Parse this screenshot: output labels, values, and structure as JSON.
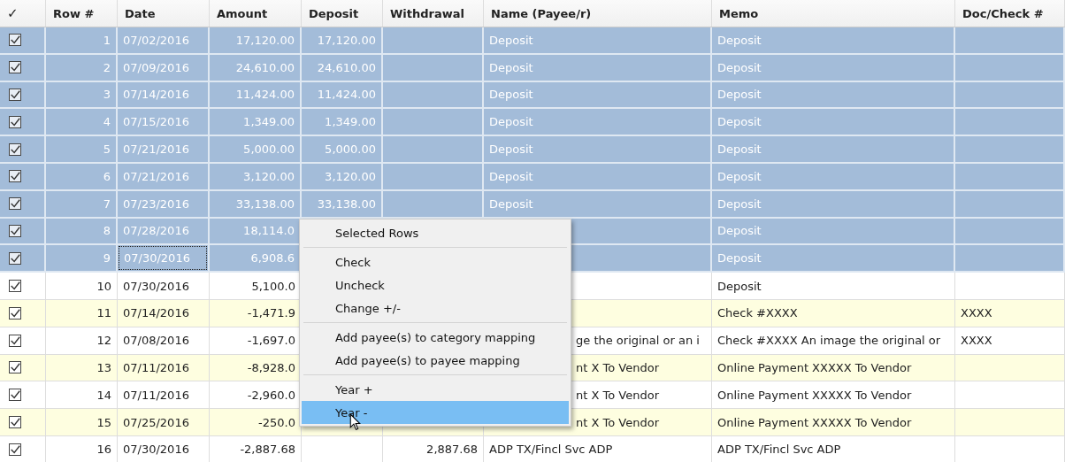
{
  "table": {
    "columns": [
      "✓",
      "Row #",
      "Date",
      "Amount",
      "Deposit",
      "Withdrawal",
      "Name (Payee/r)",
      "Memo",
      "Doc/Check #"
    ],
    "rows": [
      {
        "checked": true,
        "selected": true,
        "focused": false,
        "row": "1",
        "date": "07/02/2016",
        "amount": "17,120.00",
        "deposit": "17,120.00",
        "name": "Deposit",
        "memo": "Deposit"
      },
      {
        "checked": true,
        "selected": true,
        "focused": false,
        "row": "2",
        "date": "07/09/2016",
        "amount": "24,610.00",
        "deposit": "24,610.00",
        "name": "Deposit",
        "memo": "Deposit"
      },
      {
        "checked": true,
        "selected": true,
        "focused": false,
        "row": "3",
        "date": "07/14/2016",
        "amount": "11,424.00",
        "deposit": "11,424.00",
        "name": "Deposit",
        "memo": "Deposit"
      },
      {
        "checked": true,
        "selected": true,
        "focused": false,
        "row": "4",
        "date": "07/15/2016",
        "amount": "1,349.00",
        "deposit": "1,349.00",
        "name": "Deposit",
        "memo": "Deposit"
      },
      {
        "checked": true,
        "selected": true,
        "focused": false,
        "row": "5",
        "date": "07/21/2016",
        "amount": "5,000.00",
        "deposit": "5,000.00",
        "name": "Deposit",
        "memo": "Deposit"
      },
      {
        "checked": true,
        "selected": true,
        "focused": false,
        "row": "6",
        "date": "07/21/2016",
        "amount": "3,120.00",
        "deposit": "3,120.00",
        "name": "Deposit",
        "memo": "Deposit"
      },
      {
        "checked": true,
        "selected": true,
        "focused": false,
        "row": "7",
        "date": "07/23/2016",
        "amount": "33,138.00",
        "deposit": "33,138.00",
        "name": "Deposit",
        "memo": "Deposit"
      },
      {
        "checked": true,
        "selected": true,
        "focused": false,
        "row": "8",
        "date": "07/28/2016",
        "amount": "18,114.0",
        "memo": "Deposit"
      },
      {
        "checked": true,
        "selected": true,
        "focused": true,
        "row": "9",
        "date": "07/30/2016",
        "amount": "6,908.6",
        "memo": "Deposit"
      },
      {
        "checked": true,
        "selected": false,
        "focused": false,
        "row": "10",
        "date": "07/30/2016",
        "amount": "5,100.0",
        "memo": "Deposit"
      },
      {
        "checked": true,
        "selected": false,
        "focused": false,
        "row": "11",
        "date": "07/14/2016",
        "amount": "-1,471.9",
        "memo": "Check #XXXX",
        "doc": "XXXX"
      },
      {
        "checked": true,
        "selected": false,
        "focused": false,
        "row": "12",
        "date": "07/08/2016",
        "amount": "-1,697.0",
        "name": "ge the original or an i",
        "memo": "Check #XXXX An image the original or",
        "doc": "XXXX"
      },
      {
        "checked": true,
        "selected": false,
        "focused": false,
        "row": "13",
        "date": "07/11/2016",
        "amount": "-8,928.0",
        "name": "nt X To Vendor",
        "memo": "Online Payment XXXXX To Vendor"
      },
      {
        "checked": true,
        "selected": false,
        "focused": false,
        "row": "14",
        "date": "07/11/2016",
        "amount": "-2,960.0",
        "name": "nt X To Vendor",
        "memo": "Online Payment XXXXX To Vendor"
      },
      {
        "checked": true,
        "selected": false,
        "focused": false,
        "row": "15",
        "date": "07/25/2016",
        "amount": "-250.0",
        "name": "nt X To Vendor",
        "memo": "Online Payment XXXXX To Vendor"
      },
      {
        "checked": true,
        "selected": false,
        "focused": false,
        "row": "16",
        "date": "07/30/2016",
        "amount": "-2,887.68",
        "withdrawal": "2,887.68",
        "name": "ADP TX/Fincl Svc ADP",
        "memo": "ADP TX/Fincl Svc ADP"
      }
    ]
  },
  "context_menu": {
    "items": [
      {
        "kind": "header",
        "label": "Selected Rows"
      },
      {
        "kind": "separator"
      },
      {
        "kind": "item",
        "label": "Check",
        "selected": false
      },
      {
        "kind": "item",
        "label": "Uncheck",
        "selected": false
      },
      {
        "kind": "item",
        "label": "Change +/-",
        "selected": false
      },
      {
        "kind": "separator"
      },
      {
        "kind": "item",
        "label": "Add payee(s) to category mapping",
        "selected": false
      },
      {
        "kind": "item",
        "label": "Add payee(s) to payee mapping",
        "selected": false
      },
      {
        "kind": "separator"
      },
      {
        "kind": "item",
        "label": "Year +",
        "selected": false
      },
      {
        "kind": "item",
        "label": "Year -",
        "selected": true
      }
    ]
  }
}
